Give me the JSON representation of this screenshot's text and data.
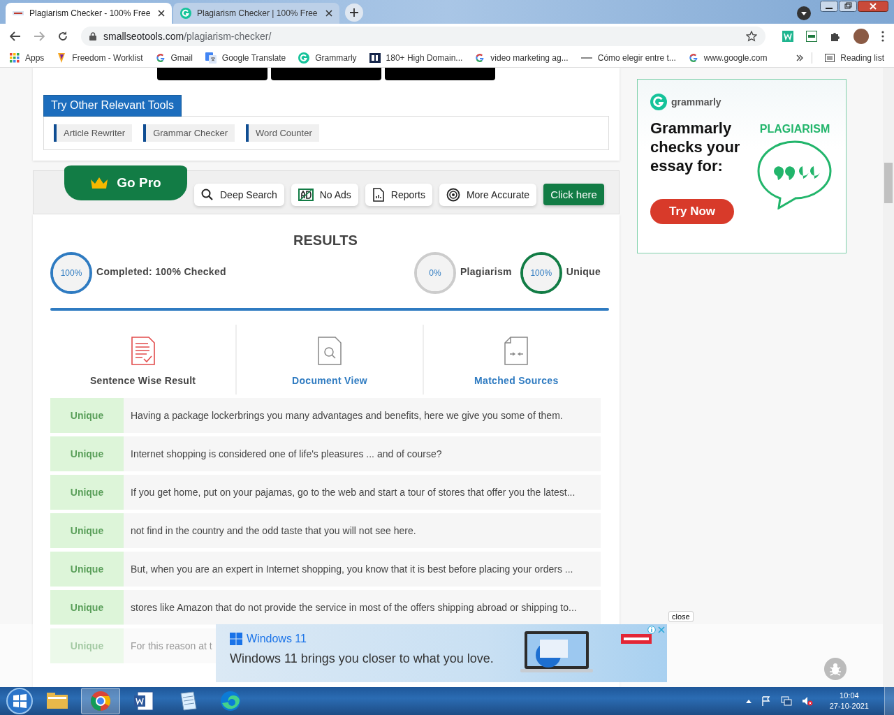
{
  "browser": {
    "tabs": [
      {
        "label": "Plagiarism Checker - 100% Free",
        "kind": "sst",
        "selected": true
      },
      {
        "label": "Plagiarism Checker | 100% Free",
        "kind": "grammarly",
        "selected": false
      }
    ],
    "url_host": "smallseotools.com",
    "url_path": "/plagiarism-checker/",
    "bookmarks": [
      {
        "label": "Apps",
        "kind": "apps"
      },
      {
        "label": "Freedom - Worklist",
        "kind": "freedom"
      },
      {
        "label": "Gmail",
        "kind": "google"
      },
      {
        "label": "Google Translate",
        "kind": "translate"
      },
      {
        "label": "Grammarly",
        "kind": "grammarly"
      },
      {
        "label": "180+ High Domain...",
        "kind": "bi"
      },
      {
        "label": "video marketing ag...",
        "kind": "google"
      },
      {
        "label": "Cómo elegir entre t...",
        "kind": "abc"
      },
      {
        "label": "www.google.com",
        "kind": "google"
      }
    ],
    "reading_list": "Reading list"
  },
  "tools": {
    "title": "Try Other Relevant Tools",
    "items": [
      "Article Rewriter",
      "Grammar Checker",
      "Word Counter"
    ]
  },
  "pro": {
    "title": "Go Pro",
    "features": [
      {
        "label": "Deep Search",
        "kind": "search"
      },
      {
        "label": "No Ads",
        "kind": "noads"
      },
      {
        "label": "Reports",
        "kind": "report"
      },
      {
        "label": "More Accurate",
        "kind": "target"
      }
    ],
    "button": "Click here"
  },
  "results": {
    "title": "RESULTS",
    "meters": [
      {
        "reading": "100%",
        "label": "Completed: 100% Checked",
        "color": "#2f7bc1"
      },
      {
        "reading": "0%",
        "label": "Plagiarism",
        "color": "#cccccc"
      },
      {
        "reading": "100%",
        "label": "Unique",
        "color": "#127c45"
      }
    ],
    "views": [
      {
        "label": "Sentence Wise Result",
        "kind": "sentences",
        "selected": true
      },
      {
        "label": "Document View",
        "kind": "document",
        "selected": false
      },
      {
        "label": "Matched Sources",
        "kind": "sources",
        "selected": false
      }
    ],
    "rows": [
      {
        "status": "Unique",
        "text": "Having a package lockerbrings you many advantages and benefits, here we give you some of them."
      },
      {
        "status": "Unique",
        "text": "Internet shopping is considered one of life's pleasures ... and of course?"
      },
      {
        "status": "Unique",
        "text": "If you get home, put on your pajamas, go to the web and start a tour of stores that offer you the latest..."
      },
      {
        "status": "Unique",
        "text": "not find in the country and the odd taste that you will not see here."
      },
      {
        "status": "Unique",
        "text": "But, when you are an expert in Internet shopping, you know that it is best before placing your orders ..."
      },
      {
        "status": "Unique",
        "text": "stores like Amazon that do not provide the service in most of the offers shipping abroad or shipping to..."
      },
      {
        "status": "Unique",
        "text": "For this reason at t"
      }
    ]
  },
  "side_ad": {
    "brand": "grammarly",
    "headline": "Grammarly checks your essay for:",
    "keyword": "PLAGIARISM",
    "button": "Try Now"
  },
  "bottom_ad": {
    "close": "close",
    "brand": "Windows 11",
    "text": "Windows 11 brings you closer to what you love."
  },
  "taskbar": {
    "apps": [
      {
        "kind": "folder",
        "active": false
      },
      {
        "kind": "chrome",
        "active": true
      },
      {
        "kind": "word",
        "active": false
      },
      {
        "kind": "notepad",
        "active": false
      },
      {
        "kind": "edge",
        "active": false
      }
    ],
    "time": "10:04",
    "date": "27-10-2021"
  }
}
